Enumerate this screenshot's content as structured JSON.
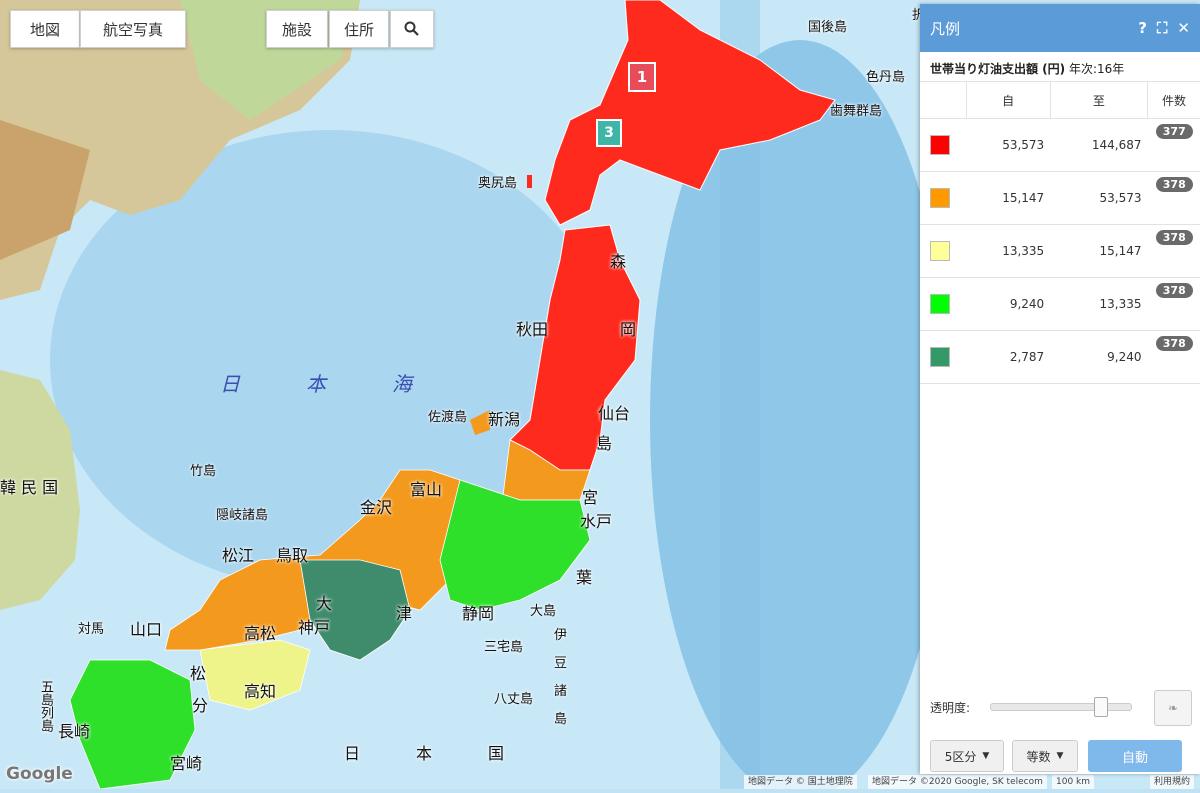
{
  "map_controls": {
    "map_tab": "地図",
    "aerial_tab": "航空写真",
    "facility_btn": "施設",
    "address_btn": "住所"
  },
  "map_labels": {
    "hokkaido_north": "択捉",
    "kunashiri": "国後島",
    "shikotan": "色丹島",
    "habomai": "歯舞群島",
    "okushiri": "奥尻島",
    "aomori": "森",
    "akita": "秋田",
    "iwate": "岡",
    "sendai": "仙台",
    "fukushima": "島",
    "niigata": "新潟",
    "sado": "佐渡島",
    "takeshima": "竹島",
    "oki": "隠岐諸島",
    "kanazawa": "金沢",
    "toyama": "富山",
    "matsue": "松江",
    "tottori": "鳥取",
    "kobe": "神戸",
    "osaka": "大",
    "tsu": "津",
    "shizuoka": "静岡",
    "mito": "水戸",
    "chiba": "葉",
    "miya": "宮",
    "oshima": "大島",
    "miyake": "三宅島",
    "hachijo": "八丈島",
    "izu": [
      "伊",
      "豆",
      "諸",
      "島"
    ],
    "yamaguchi": "山口",
    "tsushima": "対馬",
    "takamatsu": "高松",
    "matsuyama": "松",
    "kochi": "高知",
    "oita": "分",
    "nagasaki": "長崎",
    "miyazaki": "宮崎",
    "goto": "五島列島",
    "korea": "韓 民 国",
    "sea_of_japan": [
      "日",
      "本",
      "海"
    ],
    "japan": [
      "日",
      "本",
      "国"
    ],
    "google": "Google"
  },
  "legend": {
    "title": "凡例",
    "subtitle_bold": "世帯当り灯油支出額 (円)",
    "subtitle_rest": " 年次:16年",
    "col_from": "自",
    "col_to": "至",
    "col_count": "件数",
    "rows": [
      {
        "color": "#ff0000",
        "from": "53,573",
        "to": "144,687",
        "count": "377"
      },
      {
        "color": "#ff9900",
        "from": "15,147",
        "to": "53,573",
        "count": "378"
      },
      {
        "color": "#ffff99",
        "from": "13,335",
        "to": "15,147",
        "count": "378"
      },
      {
        "color": "#00ff00",
        "from": "9,240",
        "to": "13,335",
        "count": "378"
      },
      {
        "color": "#339966",
        "from": "2,787",
        "to": "9,240",
        "count": "378"
      }
    ],
    "opacity_label": "透明度:",
    "opacity_value": 0.82,
    "classes": "5区分",
    "method": "等数",
    "auto": "自動"
  },
  "attribution": {
    "a": "地図データ © 国土地理院",
    "b": "地図データ ©2020 Google, SK telecom",
    "scale": "100 km",
    "terms": "利用規約"
  }
}
